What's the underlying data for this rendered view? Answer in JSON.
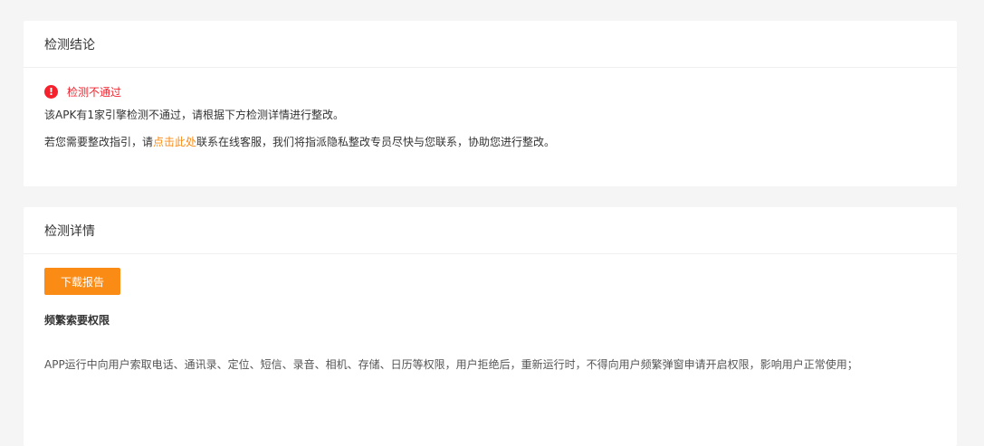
{
  "conclusion": {
    "title": "检测结论",
    "status": "检测不通过",
    "status_color": "#f5222d",
    "status_icon": "alert-icon",
    "status_icon_glyph": "!",
    "line1": "该APK有1家引擎检测不通过，请根据下方检测详情进行整改。",
    "line2_prefix": "若您需要整改指引，请",
    "line2_link": "点击此处",
    "line2_suffix": "联系在线客服，我们将指派隐私整改专员尽快与您联系，协助您进行整改。"
  },
  "details": {
    "title": "检测详情",
    "download_label": "下载报告",
    "section_title": "频繁索要权限",
    "description": "APP运行中向用户索取电话、通讯录、定位、短信、录音、相机、存储、日历等权限，用户拒绝后，重新运行时，不得向用户频繁弹窗申请开启权限，影响用户正常使用；"
  },
  "colors": {
    "accent": "#fa8c16",
    "error": "#f5222d",
    "background": "#f5f5f5",
    "card": "#ffffff"
  }
}
